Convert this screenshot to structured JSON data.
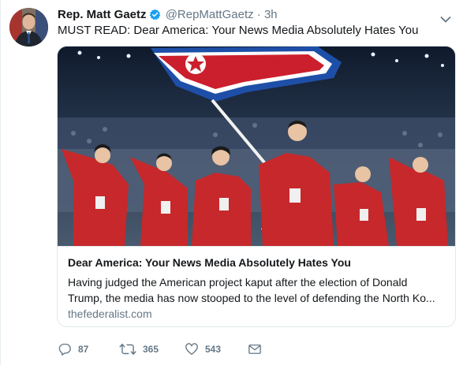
{
  "author": {
    "name": "Rep. Matt Gaetz",
    "handle": "@RepMattGaetz",
    "separator": "·",
    "time": "3h"
  },
  "tweet": {
    "text": "MUST READ: Dear America: Your News Media Absolutely Hates You"
  },
  "card": {
    "title": "Dear America: Your News Media Absolutely Hates You",
    "description_line1": "Having judged the American project kaput after the election of Donald",
    "description_line2": "Trump, the media has now stooped to the level of defending the North Ko...",
    "domain": "thefederalist.com"
  },
  "actions": {
    "replies": "87",
    "retweets": "365",
    "likes": "543"
  },
  "icons": {
    "verified": "verified-badge-icon",
    "caret": "chevron-down-icon",
    "reply": "reply-icon",
    "retweet": "retweet-icon",
    "like": "heart-icon",
    "dm": "envelope-icon"
  },
  "colors": {
    "verified": "#1da1f2",
    "text": "#14171a",
    "secondary": "#657786"
  }
}
